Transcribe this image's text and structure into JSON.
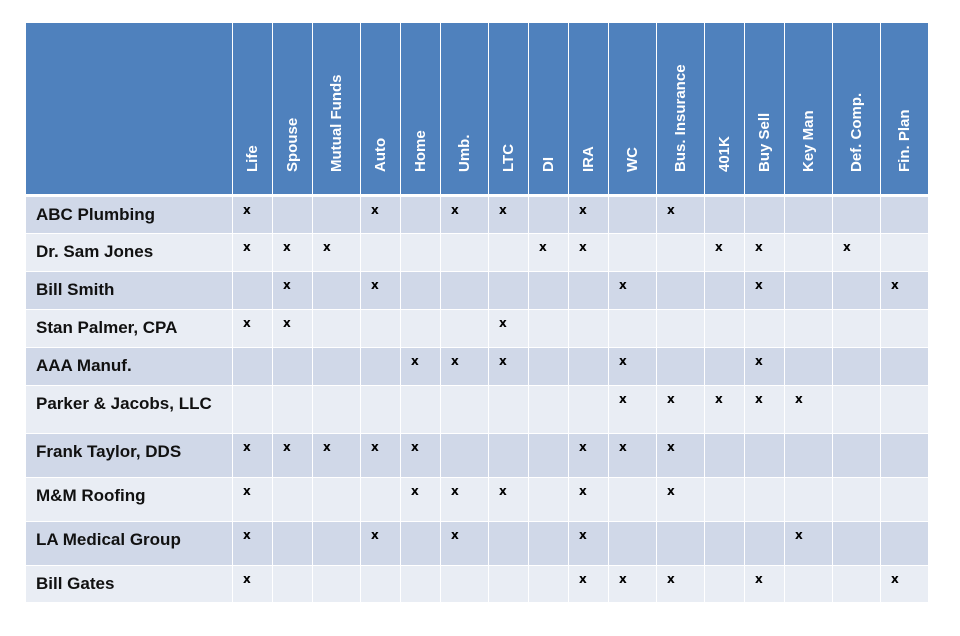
{
  "table": {
    "columns": [
      "Life",
      "Spouse",
      "Mutual Funds",
      "Auto",
      "Home",
      "Umb.",
      "LTC",
      "DI",
      "IRA",
      "WC",
      "Bus. Insurance",
      "401K",
      "Buy Sell",
      "Key Man",
      "Def. Comp.",
      "Fin. Plan"
    ],
    "mark_symbol": "x",
    "rows": [
      {
        "name": "ABC Plumbing",
        "marks": [
          "x",
          "",
          "",
          "x",
          "",
          "x",
          "x",
          "",
          "x",
          "",
          "x",
          "",
          "",
          "",
          "",
          ""
        ]
      },
      {
        "name": "Dr. Sam Jones",
        "marks": [
          "x",
          "x",
          "x",
          "",
          "",
          "",
          "",
          "x",
          "x",
          "",
          "",
          "x",
          "x",
          "",
          "x",
          ""
        ]
      },
      {
        "name": "Bill Smith",
        "marks": [
          "",
          "x",
          "",
          "x",
          "",
          "",
          "",
          "",
          "",
          "x",
          "",
          "",
          "x",
          "",
          "",
          "x"
        ]
      },
      {
        "name": "Stan Palmer, CPA",
        "marks": [
          "x",
          "x",
          "",
          "",
          "",
          "",
          "x",
          "",
          "",
          "",
          "",
          "",
          "",
          "",
          "",
          ""
        ]
      },
      {
        "name": "AAA Manuf.",
        "marks": [
          "",
          "",
          "",
          "",
          "x",
          "x",
          "x",
          "",
          "",
          "x",
          "",
          "",
          "x",
          "",
          "",
          ""
        ]
      },
      {
        "name": "Parker & Jacobs, LLC",
        "marks": [
          "",
          "",
          "",
          "",
          "",
          "",
          "",
          "",
          "",
          "x",
          "x",
          "x",
          "x",
          "x",
          "",
          ""
        ]
      },
      {
        "name": "Frank Taylor, DDS",
        "marks": [
          "x",
          "x",
          "x",
          "x",
          "x",
          "",
          "",
          "",
          "x",
          "x",
          "x",
          "",
          "",
          "",
          "",
          ""
        ]
      },
      {
        "name": "M&M Roofing",
        "marks": [
          "x",
          "",
          "",
          "",
          "x",
          "x",
          "x",
          "",
          "x",
          "",
          "x",
          "",
          "",
          "",
          "",
          ""
        ]
      },
      {
        "name": "LA Medical Group",
        "marks": [
          "x",
          "",
          "",
          "x",
          "",
          "x",
          "",
          "",
          "x",
          "",
          "",
          "",
          "",
          "x",
          "",
          ""
        ]
      },
      {
        "name": "Bill Gates",
        "marks": [
          "x",
          "",
          "",
          "",
          "",
          "",
          "",
          "",
          "x",
          "x",
          "x",
          "",
          "x",
          "",
          "",
          "x"
        ]
      }
    ]
  },
  "colors": {
    "header_bg": "#4f81bd",
    "row_odd_bg": "#d0d8e8",
    "row_even_bg": "#e9edf4",
    "grid_line": "#ffffff"
  }
}
